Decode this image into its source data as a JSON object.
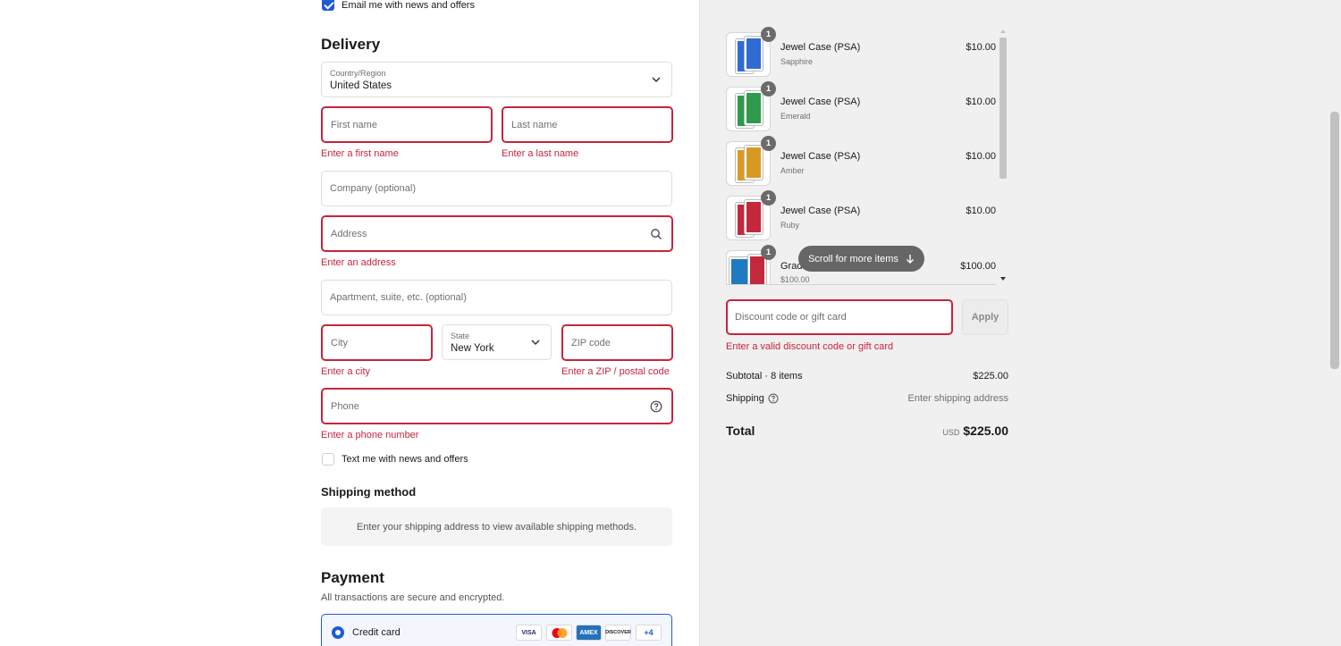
{
  "contact": {
    "email_optin_label": "Email me with news and offers",
    "email_optin_checked": true
  },
  "delivery": {
    "title": "Delivery",
    "country_label": "Country/Region",
    "country_value": "United States",
    "first_name_placeholder": "First name",
    "first_name_error": "Enter a first name",
    "last_name_placeholder": "Last name",
    "last_name_error": "Enter a last name",
    "company_placeholder": "Company (optional)",
    "address_placeholder": "Address",
    "address_error": "Enter an address",
    "apartment_placeholder": "Apartment, suite, etc. (optional)",
    "city_placeholder": "City",
    "city_error": "Enter a city",
    "state_label": "State",
    "state_value": "New York",
    "zip_placeholder": "ZIP code",
    "zip_error": "Enter a ZIP / postal code",
    "phone_placeholder": "Phone",
    "phone_error": "Enter a phone number",
    "sms_optin_label": "Text me with news and offers"
  },
  "shipping_method": {
    "title": "Shipping method",
    "message": "Enter your shipping address to view available shipping methods."
  },
  "payment": {
    "title": "Payment",
    "subtitle": "All transactions are secure and encrypted.",
    "method_label": "Credit card",
    "card_logos": [
      "VISA",
      "MC",
      "AMEX",
      "DISCOVER"
    ],
    "more_cards": "+4"
  },
  "cart": {
    "items": [
      {
        "name": "Jewel Case (PSA)",
        "variant": "Sapphire",
        "price": "$10.00",
        "qty": "1",
        "color": "#2f6bd1"
      },
      {
        "name": "Jewel Case (PSA)",
        "variant": "Emerald",
        "price": "$10.00",
        "qty": "1",
        "color": "#2f9a4b"
      },
      {
        "name": "Jewel Case (PSA)",
        "variant": "Amber",
        "price": "$10.00",
        "qty": "1",
        "color": "#d79b22"
      },
      {
        "name": "Jewel Case (PSA)",
        "variant": "Ruby",
        "price": "$10.00",
        "qty": "1",
        "color": "#c4283c"
      },
      {
        "name": "Grad",
        "variant": "$100.00",
        "price": "$100.00",
        "qty": "1",
        "color": "#1f7ac2"
      }
    ],
    "scroll_hint": "Scroll for more items",
    "discount_placeholder": "Discount code or gift card",
    "apply_label": "Apply",
    "discount_error": "Enter a valid discount code or gift card",
    "subtotal_label": "Subtotal · 8 items",
    "subtotal_value": "$225.00",
    "shipping_label": "Shipping",
    "shipping_value": "Enter shipping address",
    "total_label": "Total",
    "currency": "USD",
    "total_value": "$225.00"
  },
  "colors": {
    "accent": "#1f5bd6",
    "error": "#c8243c"
  }
}
